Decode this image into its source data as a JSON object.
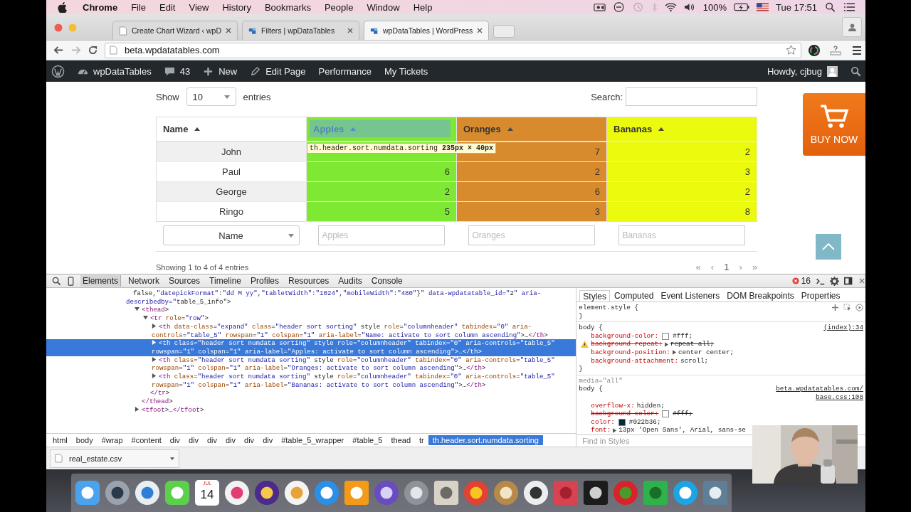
{
  "menu_bar": {
    "app": "Chrome",
    "menus": [
      "File",
      "Edit",
      "View",
      "History",
      "Bookmarks",
      "People",
      "Window",
      "Help"
    ],
    "battery": "100%",
    "clock": "Tue 17:51"
  },
  "browser": {
    "tabs": [
      {
        "title": "Create Chart Wizard ‹ wpD",
        "selected": false
      },
      {
        "title": "Filters | wpDataTables",
        "selected": false
      },
      {
        "title": "wpDataTables | WordPress",
        "selected": true
      }
    ],
    "url": "beta.wpdatatables.com"
  },
  "admin_bar": {
    "items": [
      {
        "kind": "site",
        "label": "wpDataTables"
      },
      {
        "kind": "comments",
        "label": "43"
      },
      {
        "kind": "new",
        "label": "New"
      },
      {
        "kind": "edit",
        "label": "Edit Page"
      },
      {
        "kind": "text",
        "label": "Performance"
      },
      {
        "kind": "text",
        "label": "My Tickets"
      }
    ],
    "greeting": "Howdy, cjbug"
  },
  "page": {
    "length_before": "Show",
    "page_length": "10",
    "length_after": "entries",
    "search_label": "Search:",
    "columns": [
      {
        "title": "Name",
        "color": "#ffffff",
        "inspected": false
      },
      {
        "title": "Apples",
        "color": "#7ee833",
        "inspected": true
      },
      {
        "title": "Oranges",
        "color": "#d88b2c",
        "inspected": false
      },
      {
        "title": "Bananas",
        "color": "#ecfa0d",
        "inspected": false
      }
    ],
    "rows": [
      [
        "John",
        null,
        "7",
        "2"
      ],
      [
        "Paul",
        "6",
        "2",
        "3"
      ],
      [
        "George",
        "2",
        "6",
        "2"
      ],
      [
        "Ringo",
        "5",
        "3",
        "8"
      ]
    ],
    "inspect_tooltip": {
      "selector": "th.header.sort.numdata.sorting",
      "size": "235px × 40px"
    },
    "filters": [
      {
        "kind": "select",
        "value": "Name"
      },
      {
        "kind": "text",
        "placeholder": "Apples"
      },
      {
        "kind": "text",
        "placeholder": "Oranges"
      },
      {
        "kind": "text",
        "placeholder": "Bananas"
      }
    ],
    "info": "Showing 1 to 4 of 4 entries",
    "pagination": {
      "first": "«",
      "prev": "‹",
      "page": "1",
      "next": "›",
      "last": "»"
    },
    "buy_now": "BUY NOW"
  },
  "devtools": {
    "tabs": [
      {
        "label": "Elements",
        "selected": true
      },
      {
        "label": "Network",
        "selected": false
      },
      {
        "label": "Sources",
        "selected": false
      },
      {
        "label": "Timeline",
        "selected": false
      },
      {
        "label": "Profiles",
        "selected": false
      },
      {
        "label": "Resources",
        "selected": false
      },
      {
        "label": "Audits",
        "selected": false
      },
      {
        "label": "Console",
        "selected": false
      }
    ],
    "error_count": "16",
    "dom": [
      {
        "text": "false,\"datepickFormat\":\"dd M yy\",\"tabletWidth\":\"1024\",\"mobileWidth\":\"480\"}\" data-wpdatatable_id=\"2\" aria-describedby=\"table_5_info\">",
        "selected": false,
        "children": [
          {
            "text": "<thead>",
            "expanded": true,
            "selected": false,
            "children": [
              {
                "text": "<tr role=\"row\">",
                "expanded": true,
                "selected": false,
                "children": [
                  {
                    "text": "<th data-class=\"expand\" class=\"header sort sorting\" style role=\"columnheader\" tabindex=\"0\" aria-controls=\"table_5\" rowspan=\"1\" colspan=\"1\" aria-label=\"Name: activate to sort column ascending\">…</th>",
                    "expanded": false,
                    "selected": false
                  },
                  {
                    "text": "<th class=\"header sort numdata sorting\" style role=\"columnheader\" tabindex=\"0\" aria-controls=\"table_5\" rowspan=\"1\" colspan=\"1\" aria-label=\"Apples: activate to sort column ascending\">…</th>",
                    "expanded": false,
                    "selected": true
                  },
                  {
                    "text": "<th class=\"header sort numdata sorting\" style role=\"columnheader\" tabindex=\"0\" aria-controls=\"table_5\" rowspan=\"1\" colspan=\"1\" aria-label=\"Oranges: activate to sort column ascending\">…</th>",
                    "expanded": false,
                    "selected": false
                  },
                  {
                    "text": "<th class=\"header sort numdata sorting\" style role=\"columnheader\" tabindex=\"0\" aria-controls=\"table_5\" rowspan=\"1\" colspan=\"1\" aria-label=\"Bananas: activate to sort column ascending\">…</th>",
                    "expanded": false,
                    "selected": false
                  }
                ]
              },
              {
                "text": "</tr>",
                "selected": false
              }
            ]
          },
          {
            "text": "</thead>",
            "selected": false
          },
          {
            "text": "<tfoot>…</tfoot>",
            "expanded": false,
            "selected": false
          }
        ]
      }
    ],
    "breadcrumbs": [
      {
        "label": "html",
        "selected": false
      },
      {
        "label": "body",
        "selected": false
      },
      {
        "label": "#wrap",
        "selected": false
      },
      {
        "label": "#content",
        "selected": false
      },
      {
        "label": "div",
        "selected": false
      },
      {
        "label": "div",
        "selected": false
      },
      {
        "label": "div",
        "selected": false
      },
      {
        "label": "div",
        "selected": false
      },
      {
        "label": "div",
        "selected": false
      },
      {
        "label": "div",
        "selected": false
      },
      {
        "label": "#table_5_wrapper",
        "selected": false
      },
      {
        "label": "#table_5",
        "selected": false
      },
      {
        "label": "thead",
        "selected": false
      },
      {
        "label": "tr",
        "selected": false
      },
      {
        "label": "th.header.sort.numdata.sorting",
        "selected": true
      }
    ],
    "style_tabs": [
      {
        "label": "Styles",
        "selected": true
      },
      {
        "label": "Computed",
        "selected": false
      },
      {
        "label": "Event Listeners",
        "selected": false
      },
      {
        "label": "DOM Breakpoints",
        "selected": false
      },
      {
        "label": "Properties",
        "selected": false
      }
    ],
    "rules": [
      {
        "selector": "element.style {",
        "close": "}"
      },
      {
        "selector": "body {",
        "source": [
          "(index):34"
        ],
        "close": "}",
        "properties": [
          {
            "name": "background-color:",
            "value": "#fff;",
            "color": "#ffffff",
            "struck": false,
            "warning": false,
            "expandable": false
          },
          {
            "name": "background-repeat:",
            "value": "repeat-all;",
            "struck": true,
            "warning": true,
            "expandable": true
          },
          {
            "name": "background-position:",
            "value": "center center;",
            "struck": false,
            "warning": false,
            "expandable": true
          },
          {
            "name": "background-attachment:",
            "value": "scroll;",
            "struck": false,
            "warning": false,
            "expandable": false
          }
        ]
      },
      {
        "media": "media=\"all\"",
        "selector": "body {",
        "source": [
          "beta.wpdatatables.com/",
          "base.css:108"
        ],
        "properties": [
          {
            "name": "overflow-x:",
            "value": "hidden;",
            "struck": false,
            "warning": false,
            "expandable": false
          },
          {
            "name": "background-color:",
            "value": "#fff;",
            "color": "#ffffff",
            "struck": true,
            "warning": false,
            "expandable": false
          },
          {
            "name": "color:",
            "value": "#022b36;",
            "color": "#022b36",
            "struck": false,
            "warning": false,
            "expandable": false
          },
          {
            "name": "font:",
            "value": "13px 'Open Sans', Arial, sans-se",
            "struck": false,
            "warning": false,
            "expandable": true
          }
        ]
      }
    ],
    "filter_placeholder": "Find in Styles"
  },
  "download_bar": {
    "file": "real_estate.csv"
  },
  "dock": {
    "calendar_month": "JUL",
    "calendar_day": "14"
  }
}
